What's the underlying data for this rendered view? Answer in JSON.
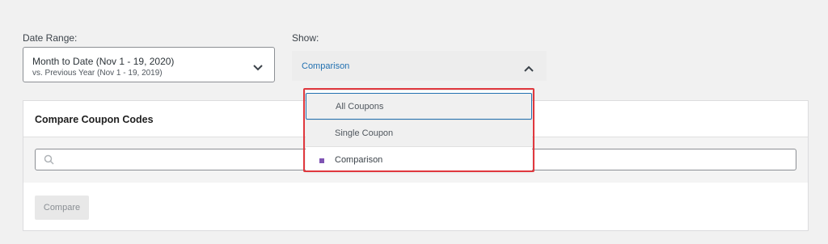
{
  "date_range": {
    "label": "Date Range:",
    "primary": "Month to Date (Nov 1 - 19, 2020)",
    "secondary": "vs. Previous Year (Nov 1 - 19, 2019)"
  },
  "show": {
    "label": "Show:",
    "value": "Comparison",
    "options": [
      "All Coupons",
      "Single Coupon",
      "Comparison"
    ],
    "selected": "Comparison"
  },
  "card": {
    "title": "Compare Coupon Codes",
    "search_placeholder": "",
    "compare_label": "Compare"
  },
  "colors": {
    "accent": "#2271b1",
    "highlight": "#e0383e",
    "selected_marker": "#7f54b3"
  }
}
